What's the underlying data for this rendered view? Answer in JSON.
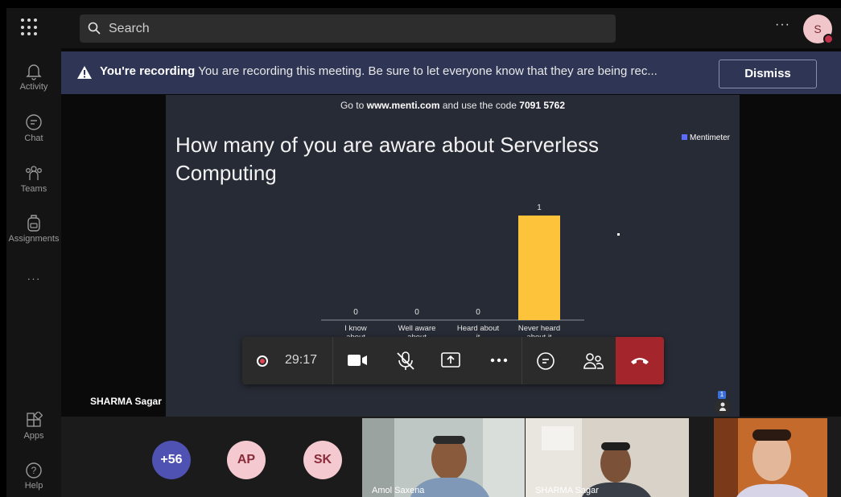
{
  "search": {
    "placeholder": "Search"
  },
  "topbar": {
    "more_label": "···",
    "user_initial": "S"
  },
  "rail": {
    "items": [
      {
        "label": "Activity",
        "icon": "bell-icon"
      },
      {
        "label": "Chat",
        "icon": "chat-icon"
      },
      {
        "label": "Teams",
        "icon": "teams-icon"
      },
      {
        "label": "Assignments",
        "icon": "backpack-icon"
      },
      {
        "label": "···",
        "icon": "more-icon"
      },
      {
        "label": "Apps",
        "icon": "apps-icon"
      },
      {
        "label": "Help",
        "icon": "help-icon"
      }
    ]
  },
  "banner": {
    "bold": "You're recording",
    "message": " You are recording this meeting. Be sure to let everyone know that they are being rec...",
    "dismiss_label": "Dismiss"
  },
  "slide": {
    "code_prefix": "Go to ",
    "url": "www.menti.com",
    "code_mid": " and use the code ",
    "code": "7091 5762",
    "brand": "Mentimeter",
    "question": "How many of you are aware about Serverless Computing"
  },
  "chart_data": {
    "type": "bar",
    "categories": [
      "I know about",
      "Well aware about",
      "Heard about it",
      "Never heard about it"
    ],
    "values": [
      0,
      0,
      0,
      1
    ],
    "color": "#fdc33a",
    "ylim": [
      0,
      1
    ]
  },
  "presenter": {
    "name": "SHARMA Sagar"
  },
  "raised_hands": {
    "count": "1"
  },
  "controls": {
    "timer": "29:17",
    "recording": true
  },
  "gallery": {
    "overflow": "+56",
    "avatars": [
      {
        "initials": "AP",
        "bg": "#f4c9d0",
        "fg": "#8a2b3a"
      },
      {
        "initials": "SK",
        "bg": "#f4c9d0",
        "fg": "#8a2b3a"
      }
    ],
    "videos": [
      {
        "name": "Amol Saxena"
      },
      {
        "name": "SHARMA Sagar"
      },
      {
        "name": ""
      }
    ]
  },
  "colors": {
    "accent": "#6264a7",
    "banner": "#2f3655",
    "hangup": "#a4262c",
    "bar": "#fdc33a"
  }
}
